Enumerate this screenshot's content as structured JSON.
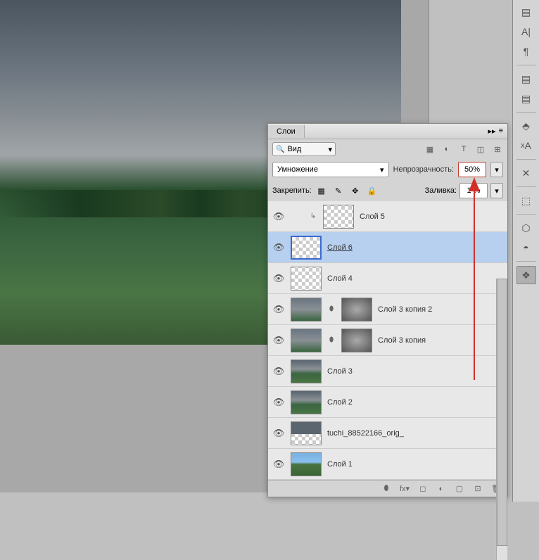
{
  "panel": {
    "tab": "Слои",
    "filter_label": "Вид",
    "blend_mode": "Умножение",
    "opacity_label": "Непрозрачность:",
    "opacity_value": "50%",
    "lock_label": "Закрепить:",
    "fill_label": "Заливка:",
    "fill_value": "1  %"
  },
  "layers": [
    {
      "name": "Слой 5",
      "clipped": true,
      "thumb": "checker",
      "selected": false
    },
    {
      "name": "Слой 6",
      "clipped": false,
      "thumb": "checker",
      "selected": true
    },
    {
      "name": "Слой 4",
      "clipped": false,
      "thumb": "checker",
      "selected": false
    },
    {
      "name": "Слой 3 копия 2",
      "clipped": false,
      "thumb": "rain",
      "mask": "clouds",
      "selected": false
    },
    {
      "name": "Слой 3 копия",
      "clipped": false,
      "thumb": "rain",
      "mask": "clouds",
      "selected": false
    },
    {
      "name": "Слой 3",
      "clipped": false,
      "thumb": "mixed",
      "selected": false
    },
    {
      "name": "Слой 2",
      "clipped": false,
      "thumb": "mixed",
      "selected": false
    },
    {
      "name": "tuchi_88522166_orig_",
      "clipped": false,
      "thumb": "tuchi",
      "selected": false
    },
    {
      "name": "Слой 1",
      "clipped": false,
      "thumb": "green",
      "selected": false
    }
  ],
  "toolbar_icons": [
    "image",
    "adjust",
    "text",
    "transform",
    "mask"
  ],
  "lock_icons": [
    "transparency",
    "brush",
    "move",
    "lock"
  ],
  "footer_icons": [
    "link",
    "fx",
    "mask",
    "adjustment",
    "group",
    "new",
    "delete"
  ],
  "right_tools": [
    "history",
    "char",
    "para",
    "swatches",
    "styles",
    "sep",
    "adjustments",
    "char2",
    "sep",
    "tools",
    "sep",
    "nav",
    "info",
    "sep",
    "actions",
    "sep",
    "3d",
    "materials",
    "sep",
    "layers"
  ]
}
